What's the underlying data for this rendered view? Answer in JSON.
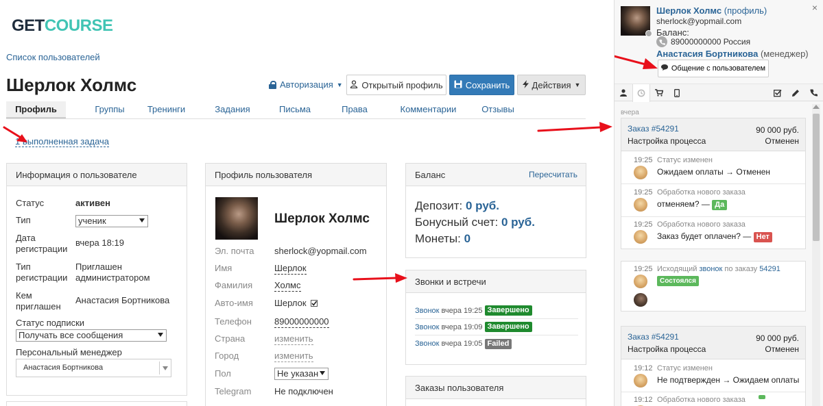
{
  "logo": {
    "get": "GET",
    "course": "COURSE"
  },
  "breadcrumb": "Список пользователей",
  "page_title": "Шерлок Холмс",
  "header": {
    "auth_label": "Авторизация",
    "open_profile_label": "Открытый профиль",
    "save_label": "Сохранить",
    "actions_label": "Действия"
  },
  "tabs": [
    "Профиль",
    "Группы",
    "Тренинги",
    "Задания",
    "Письма",
    "Права",
    "Комментарии",
    "Отзывы"
  ],
  "task_link": "1 выполненная задача",
  "user_info": {
    "title": "Информация о пользователе",
    "status_label": "Статус",
    "status_value": "активен",
    "type_label": "Тип",
    "type_value": "ученик",
    "reg_date_label_1": "Дата",
    "reg_date_label_2": "регистрации",
    "reg_date_value": "вчера 18:19",
    "reg_type_label_1": "Тип",
    "reg_type_label_2": "регистрации",
    "reg_type_value_1": "Приглашен",
    "reg_type_value_2": "администратором",
    "invited_label_1": "Кем",
    "invited_label_2": "приглашен",
    "invited_value": "Анастасия Бортникова",
    "subscription_label": "Статус подписки",
    "subscription_value": "Получать все сообщения",
    "manager_label": "Персональный менеджер",
    "manager_value": "Анастасия Бортникова"
  },
  "profile": {
    "title": "Профиль пользователя",
    "name": "Шерлок Холмс",
    "email_label": "Эл. почта",
    "email_value": "sherlock@yopmail.com",
    "first_label": "Имя",
    "first_value": "Шерлок",
    "last_label": "Фамилия",
    "last_value": "Холмс",
    "auto_label": "Авто-имя",
    "auto_value": "Шерлок",
    "phone_label": "Телефон",
    "phone_value": "89000000000",
    "country_label": "Страна",
    "country_value": "изменить",
    "city_label": "Город",
    "city_value": "изменить",
    "gender_label": "Пол",
    "gender_value": "Не указан",
    "telegram_label": "Telegram",
    "telegram_value": "Не подключен"
  },
  "balance": {
    "title": "Баланс",
    "recalc": "Пересчитать",
    "deposit_label": "Депозит:",
    "deposit_value": "0 руб.",
    "bonus_label": "Бонусный счет:",
    "bonus_value": "0 руб.",
    "coins_label": "Монеты:",
    "coins_value": "0"
  },
  "calls": {
    "title": "Звонки и встречи",
    "items": [
      {
        "link": "Звонок",
        "time": "вчера 19:25",
        "status": "Завершено"
      },
      {
        "link": "Звонок",
        "time": "вчера 19:09",
        "status": "Завершено"
      },
      {
        "link": "Звонок",
        "time": "вчера 19:05",
        "status": "Failed"
      }
    ]
  },
  "orders_panel": {
    "title": "Заказы пользователя"
  },
  "sidebar": {
    "user_name": "Шерлок Холмс",
    "profile_link": "(профиль)",
    "email": "sherlock@yopmail.com",
    "balance_label": "Баланс:",
    "phone": "89000000000 Россия",
    "manager_name": "Анастасия Бортникова",
    "manager_role": "(менеджер)",
    "chat_button": "Общение с пользователем",
    "close": "×",
    "day_label": "вчера",
    "card1": {
      "order": "Заказ #54291",
      "amount": "90 000 руб.",
      "process": "Настройка процесса",
      "status": "Отменен",
      "events": [
        {
          "time": "19:25",
          "head": "Статус изменен",
          "body": "Ожидаем оплаты → Отменен"
        },
        {
          "time": "19:25",
          "head": "Обработка нового заказа",
          "body": "отменяем? —",
          "badge": "Да"
        },
        {
          "time": "19:25",
          "head": "Обработка нового заказа",
          "body": "Заказ будет оплачен? —",
          "badge": "Нет"
        }
      ]
    },
    "call_card": {
      "time": "19:25",
      "prefix": "Исходящий",
      "link": "звонок",
      "mid": "по заказу",
      "order": "54291",
      "badge": "Состоялся"
    },
    "card2": {
      "order": "Заказ #54291",
      "amount": "90 000 руб.",
      "process": "Настройка процесса",
      "status": "Отменен",
      "events": [
        {
          "time": "19:12",
          "head": "Статус изменен",
          "body": "Не подтвержден → Ожидаем оплаты"
        },
        {
          "time": "19:12",
          "head": "Обработка нового заказа"
        }
      ]
    }
  },
  "colors": {
    "brand_teal": "#41c4b4",
    "primary": "#337ab7",
    "link": "#2a6496",
    "arrow": "#e8101b",
    "success": "#1f8a2e"
  }
}
